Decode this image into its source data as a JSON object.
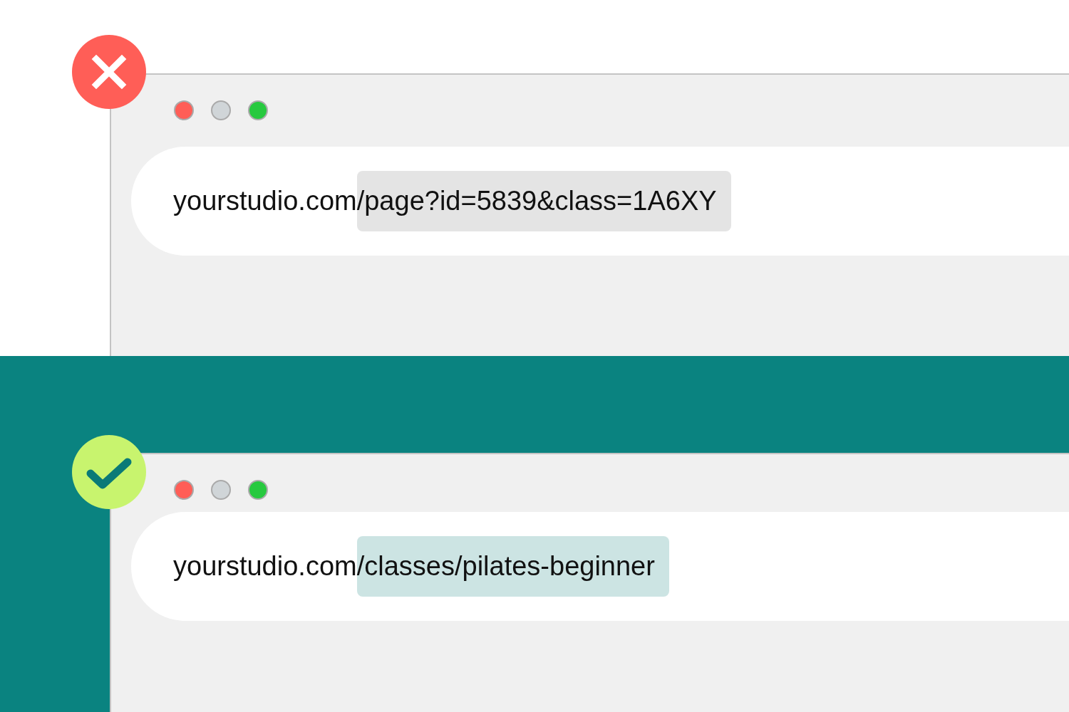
{
  "panels": [
    {
      "kind": "bad",
      "url_domain": "yourstudio.com",
      "url_path": "/page?id=5839&class=1A6XY"
    },
    {
      "kind": "good",
      "url_domain": "yourstudio.com",
      "url_path": "/classes/pilates-beginner"
    }
  ]
}
